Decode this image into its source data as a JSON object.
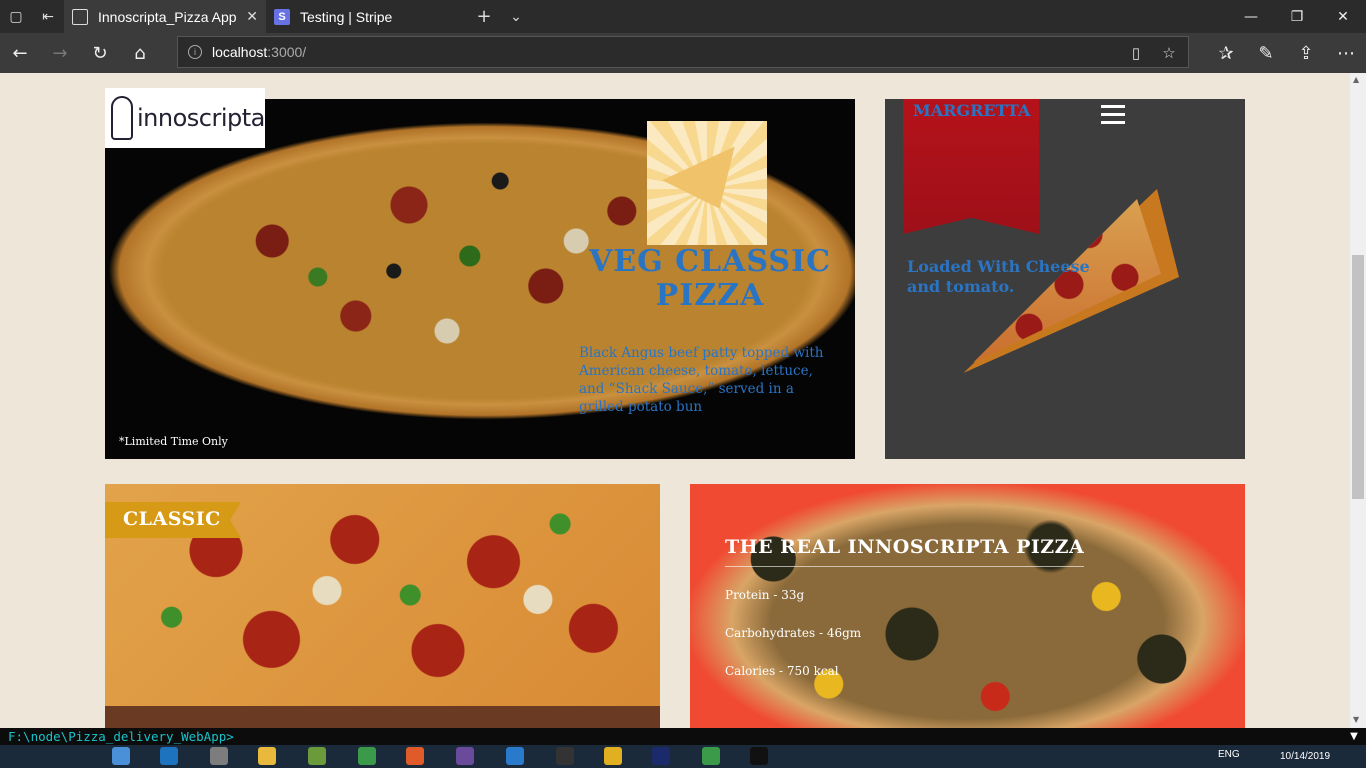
{
  "browser": {
    "tabs": [
      {
        "title": "Innoscripta_Pizza App",
        "active": true
      },
      {
        "title": "Testing | Stripe",
        "active": false,
        "favicon_letter": "S"
      }
    ],
    "url_host": "localhost",
    "url_path": ":3000/"
  },
  "hero": {
    "logo_text": "innoscripta",
    "title": "VEG CLASSIC PIZZA",
    "description": "Black Angus beef patty topped with American cheese, tomato, lettuce, and “Shack Sauce,” served in a grilled potato bun",
    "note": "*Limited Time Only"
  },
  "margretta": {
    "ribbon_label": "MARGRETTA",
    "text": "Loaded With Cheese and tomato."
  },
  "classic": {
    "tag": "CLASSIC"
  },
  "real": {
    "title": "THE REAL INNOSCRIPTA PIZZA",
    "protein": "Protein - 33g",
    "carbs": "Carbohydrates - 46gm",
    "calories": "Calories - 750 kcal"
  },
  "terminal": {
    "prompt": "F:\\node\\Pizza_delivery_WebApp>"
  },
  "taskbar": {
    "lang": "ENG",
    "date": "10/14/2019"
  },
  "colors": {
    "accent_blue": "#2a74c4",
    "ribbon_red": "#b5121b",
    "classic_tag": "#d69a16",
    "page_bg": "#efe6da"
  }
}
